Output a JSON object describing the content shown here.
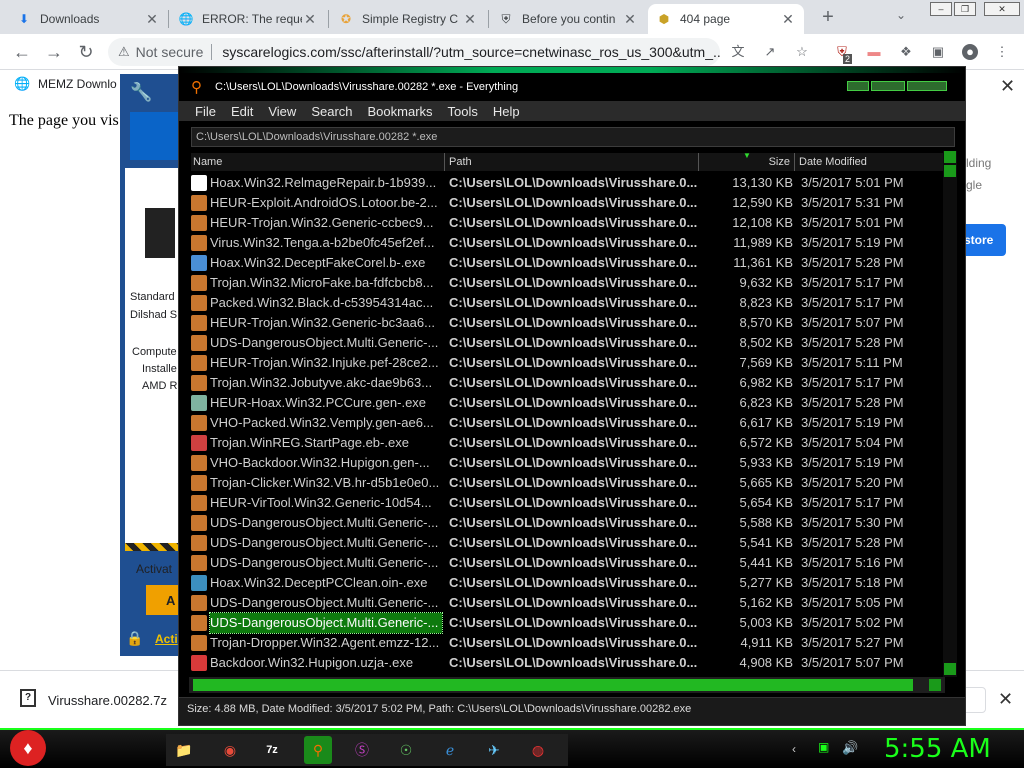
{
  "browser": {
    "tabs": [
      {
        "title": "Downloads",
        "icon": "download-icon"
      },
      {
        "title": "ERROR: The reque",
        "icon": "globe-icon"
      },
      {
        "title": "Simple Registry C",
        "icon": "star-badge-icon"
      },
      {
        "title": "Before you contin",
        "icon": "shield-icon"
      },
      {
        "title": "404 page",
        "icon": "cube-icon"
      }
    ],
    "address": {
      "security_label": "Not secure",
      "url": "syscarelogics.com/ssc/afterinstall/?utm_source=cnetwinasc_ros_us_300&utm_..."
    },
    "bookmark": "MEMZ Downlo",
    "extension_badge": "2"
  },
  "page": {
    "text": "The page you vis",
    "ad_labels": [
      "Standard",
      "Dilshad S",
      "Compute",
      "Installe",
      "AMD R",
      "Activat",
      "Acti"
    ],
    "right_fragments": [
      "lding",
      "gle",
      "store"
    ]
  },
  "download": {
    "filename": "Virusshare.00282.7z"
  },
  "everything": {
    "title": "C:\\Users\\LOL\\Downloads\\Virusshare.00282 *.exe - Everything",
    "menus": [
      "File",
      "Edit",
      "View",
      "Search",
      "Bookmarks",
      "Tools",
      "Help"
    ],
    "search_value": "C:\\Users\\LOL\\Downloads\\Virusshare.00282 *.exe",
    "columns": [
      "Name",
      "Path",
      "Size",
      "Date Modified"
    ],
    "rows": [
      {
        "name": "Hoax.Win32.RelmageRepair.b-1b939...",
        "path": "C:\\Users\\LOL\\Downloads\\Virusshare.0...",
        "size": "13,130 KB",
        "date": "3/5/2017 5:01 PM",
        "icon": "re-icon",
        "color": "#ffffff"
      },
      {
        "name": "HEUR-Exploit.AndroidOS.Lotoor.be-2...",
        "path": "C:\\Users\\LOL\\Downloads\\Virusshare.0...",
        "size": "12,590 KB",
        "date": "3/5/2017 5:31 PM",
        "icon": "exe-icon",
        "color": "#c9772f"
      },
      {
        "name": "HEUR-Trojan.Win32.Generic-ccbec9...",
        "path": "C:\\Users\\LOL\\Downloads\\Virusshare.0...",
        "size": "12,108 KB",
        "date": "3/5/2017 5:01 PM",
        "icon": "exe-icon",
        "color": "#c9772f"
      },
      {
        "name": "Virus.Win32.Tenga.a-b2be0fc45ef2ef...",
        "path": "C:\\Users\\LOL\\Downloads\\Virusshare.0...",
        "size": "11,989 KB",
        "date": "3/5/2017 5:19 PM",
        "icon": "exe-icon",
        "color": "#c9772f"
      },
      {
        "name": "Hoax.Win32.DeceptFakeCorel.b-.exe",
        "path": "C:\\Users\\LOL\\Downloads\\Virusshare.0...",
        "size": "11,361 KB",
        "date": "3/5/2017 5:28 PM",
        "icon": "gear-app-icon",
        "color": "#4a8fd6"
      },
      {
        "name": "Trojan.Win32.MicroFake.ba-fdfcbcb8...",
        "path": "C:\\Users\\LOL\\Downloads\\Virusshare.0...",
        "size": "9,632 KB",
        "date": "3/5/2017 5:17 PM",
        "icon": "exe-icon",
        "color": "#c9772f"
      },
      {
        "name": "Packed.Win32.Black.d-c53954314ac...",
        "path": "C:\\Users\\LOL\\Downloads\\Virusshare.0...",
        "size": "8,823 KB",
        "date": "3/5/2017 5:17 PM",
        "icon": "exe-icon",
        "color": "#c9772f"
      },
      {
        "name": "HEUR-Trojan.Win32.Generic-bc3aa6...",
        "path": "C:\\Users\\LOL\\Downloads\\Virusshare.0...",
        "size": "8,570 KB",
        "date": "3/5/2017 5:07 PM",
        "icon": "exe-icon",
        "color": "#c9772f"
      },
      {
        "name": "UDS-DangerousObject.Multi.Generic-...",
        "path": "C:\\Users\\LOL\\Downloads\\Virusshare.0...",
        "size": "8,502 KB",
        "date": "3/5/2017 5:28 PM",
        "icon": "exe-icon",
        "color": "#c9772f"
      },
      {
        "name": "HEUR-Trojan.Win32.Injuke.pef-28ce2...",
        "path": "C:\\Users\\LOL\\Downloads\\Virusshare.0...",
        "size": "7,569 KB",
        "date": "3/5/2017 5:11 PM",
        "icon": "exe-icon",
        "color": "#c9772f"
      },
      {
        "name": "Trojan.Win32.Jobutyve.akc-dae9b63...",
        "path": "C:\\Users\\LOL\\Downloads\\Virusshare.0...",
        "size": "6,982 KB",
        "date": "3/5/2017 5:17 PM",
        "icon": "exe-icon",
        "color": "#c9772f"
      },
      {
        "name": "HEUR-Hoax.Win32.PCCure.gen-.exe",
        "path": "C:\\Users\\LOL\\Downloads\\Virusshare.0...",
        "size": "6,823 KB",
        "date": "3/5/2017 5:28 PM",
        "icon": "avatar-app-icon",
        "color": "#7fb3a0"
      },
      {
        "name": "VHO-Packed.Win32.Vemply.gen-ae6...",
        "path": "C:\\Users\\LOL\\Downloads\\Virusshare.0...",
        "size": "6,617 KB",
        "date": "3/5/2017 5:19 PM",
        "icon": "exe-icon",
        "color": "#c9772f"
      },
      {
        "name": "Trojan.WinREG.StartPage.eb-.exe",
        "path": "C:\\Users\\LOL\\Downloads\\Virusshare.0...",
        "size": "6,572 KB",
        "date": "3/5/2017 5:04 PM",
        "icon": "flag-app-icon",
        "color": "#d04040"
      },
      {
        "name": "VHO-Backdoor.Win32.Hupigon.gen-...",
        "path": "C:\\Users\\LOL\\Downloads\\Virusshare.0...",
        "size": "5,933 KB",
        "date": "3/5/2017 5:19 PM",
        "icon": "exe-icon",
        "color": "#c9772f"
      },
      {
        "name": "Trojan-Clicker.Win32.VB.hr-d5b1e0e0...",
        "path": "C:\\Users\\LOL\\Downloads\\Virusshare.0...",
        "size": "5,665 KB",
        "date": "3/5/2017 5:20 PM",
        "icon": "exe-icon",
        "color": "#c9772f"
      },
      {
        "name": "HEUR-VirTool.Win32.Generic-10d54...",
        "path": "C:\\Users\\LOL\\Downloads\\Virusshare.0...",
        "size": "5,654 KB",
        "date": "3/5/2017 5:17 PM",
        "icon": "exe-icon",
        "color": "#c9772f"
      },
      {
        "name": "UDS-DangerousObject.Multi.Generic-...",
        "path": "C:\\Users\\LOL\\Downloads\\Virusshare.0...",
        "size": "5,588 KB",
        "date": "3/5/2017 5:30 PM",
        "icon": "exe-icon",
        "color": "#c9772f"
      },
      {
        "name": "UDS-DangerousObject.Multi.Generic-...",
        "path": "C:\\Users\\LOL\\Downloads\\Virusshare.0...",
        "size": "5,541 KB",
        "date": "3/5/2017 5:28 PM",
        "icon": "exe-icon",
        "color": "#c9772f"
      },
      {
        "name": "UDS-DangerousObject.Multi.Generic-...",
        "path": "C:\\Users\\LOL\\Downloads\\Virusshare.0...",
        "size": "5,441 KB",
        "date": "3/5/2017 5:16 PM",
        "icon": "exe-icon",
        "color": "#c9772f"
      },
      {
        "name": "Hoax.Win32.DeceptPCClean.oin-.exe",
        "path": "C:\\Users\\LOL\\Downloads\\Virusshare.0...",
        "size": "5,277 KB",
        "date": "3/5/2017 5:18 PM",
        "icon": "disc-app-icon",
        "color": "#3c8fbf"
      },
      {
        "name": "UDS-DangerousObject.Multi.Generic-...",
        "path": "C:\\Users\\LOL\\Downloads\\Virusshare.0...",
        "size": "5,162 KB",
        "date": "3/5/2017 5:05 PM",
        "icon": "exe-icon",
        "color": "#c9772f"
      },
      {
        "name": "UDS-DangerousObject.Multi.Generic-...",
        "path": "C:\\Users\\LOL\\Downloads\\Virusshare.0...",
        "size": "5,003 KB",
        "date": "3/5/2017 5:02 PM",
        "icon": "exe-icon",
        "color": "#c9772f",
        "selected": true
      },
      {
        "name": "Trojan-Dropper.Win32.Agent.emzz-12...",
        "path": "C:\\Users\\LOL\\Downloads\\Virusshare.0...",
        "size": "4,911 KB",
        "date": "3/5/2017 5:27 PM",
        "icon": "exe-icon",
        "color": "#c9772f"
      },
      {
        "name": "Backdoor.Win32.Hupigon.uzja-.exe",
        "path": "C:\\Users\\LOL\\Downloads\\Virusshare.0...",
        "size": "4,908 KB",
        "date": "3/5/2017 5:07 PM",
        "icon": "ball-app-icon",
        "color": "#d83a3a"
      }
    ],
    "status": "Size: 4.88 MB, Date Modified: 3/5/2017 5:02 PM, Path: C:\\Users\\LOL\\Downloads\\Virusshare.00282.exe"
  },
  "taskbar": {
    "clock": "5:55 AM",
    "apps": [
      "file-explorer-icon",
      "chrome-icon",
      "7zip-icon",
      "everything-icon",
      "app-s-icon",
      "app-globe-icon",
      "ie-icon",
      "app-bird-icon",
      "app-ball-icon"
    ]
  },
  "colors": {
    "accent_green": "#1aff1a",
    "selection_green": "#0e7a0e"
  }
}
